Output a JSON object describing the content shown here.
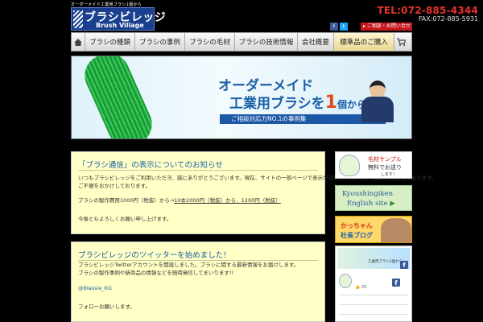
{
  "header": {
    "tagline": "オーダーメイド工業用ブラシ1個から",
    "logo_jp": "ブラシビレッジ",
    "logo_en": "Brush Village",
    "tel": "TEL:072-885-4344",
    "fax": "FAX:072-885-5931",
    "icons": [
      "facebook-icon",
      "twitter-icon"
    ],
    "contact_label": "ご相談・お問い合せ"
  },
  "nav": {
    "items": [
      {
        "label": "ブラシの種類"
      },
      {
        "label": "ブラシの事例"
      },
      {
        "label": "ブラシの毛材"
      },
      {
        "label": "ブラシの技術情報"
      },
      {
        "label": "会社概要"
      },
      {
        "label": "標準品のご購入"
      }
    ],
    "icons": [
      "home-icon",
      "cart-icon"
    ]
  },
  "banner": {
    "line1": "オーダーメイド",
    "line2_a": "工業用ブラシを",
    "line2_b": "1",
    "line2_c": "個から",
    "strip": "ご相談対応力NO.1の事例集"
  },
  "posts": [
    {
      "title": "「ブラシ通信」の表示についてのお知らせ",
      "lines": [
        "いつもブラシビレッジをご利用いただき、誠にありがとうございます。現在、サイトの一部ページで表示が正しく行われない不具合が発生しております。",
        "ご不便をおかけしております。",
        "ブラシの製作費用1000円（税抜）から→",
        "10本2000円（税抜）から、1200円（税抜）"
      ],
      "footer": "今後ともよろしくお願い申し上げます。"
    },
    {
      "title": "ブラシビレッジのツイッターを始めました！",
      "lines": [
        "ブラシビレッジTwitterアカウントを開設しました。ブラシに関する最新情報をお届けします。",
        "ブラシの製作事例や新商品の情報などを随時発信してまいります!!"
      ],
      "handle": "@Blassie_KG",
      "footer": "フォローお願いします。"
    }
  ],
  "sidebar": {
    "sample_line1": "毛材サンプル",
    "sample_line2": "無料でお送り",
    "sample_line3": "します！",
    "english_line1": "Kyoushingiken",
    "english_line2": "English site",
    "blog_line1": "かっちゃん",
    "blog_line2": "社長ブログ",
    "fb_banner_text": "工業用ブラシ1個から",
    "fb_like_count": "25"
  }
}
